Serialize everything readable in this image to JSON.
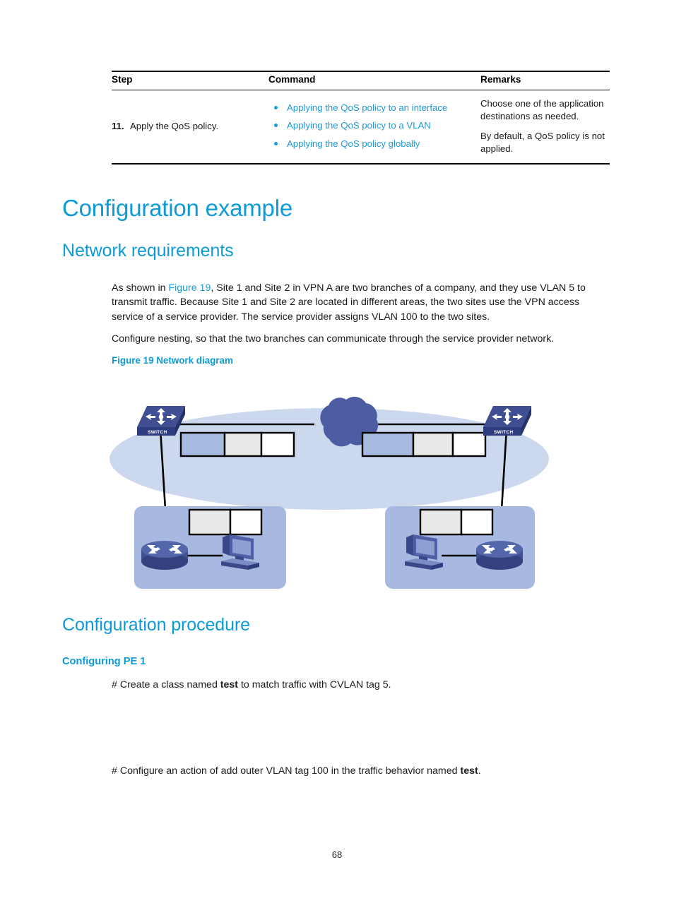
{
  "table": {
    "headers": [
      "Step",
      "Command",
      "Remarks"
    ],
    "rows": [
      {
        "step_number": "11.",
        "step_label": "Apply the QoS policy.",
        "commands": [
          "Applying the QoS policy to an interface",
          "Applying the QoS policy to a VLAN",
          "Applying the QoS policy globally"
        ],
        "remarks": [
          "Choose one of the application destinations as needed.",
          "By default, a QoS policy is not applied."
        ]
      }
    ]
  },
  "headings": {
    "configuration_example": "Configuration example",
    "network_requirements": "Network requirements",
    "configuration_procedure": "Configuration procedure",
    "configuring_pe1": "Configuring PE 1"
  },
  "body": {
    "intro_pre": "As shown in ",
    "intro_link": "Figure 19",
    "intro_post": ", Site 1 and Site 2 in VPN A are two branches of a company, and they use VLAN 5 to transmit traffic. Because Site 1 and Site 2 are located in different areas, the two sites use the VPN access service of a service provider. The service provider assigns VLAN 100 to the two sites.",
    "nesting": "Configure nesting, so that the two branches can communicate through the service provider network.",
    "figure_caption": "Figure 19 Network diagram",
    "create_class_pre": "# Create a class named ",
    "create_class_bold": "test",
    "create_class_post": " to match traffic with CVLAN tag 5.",
    "action_pre": "# Configure an action of add outer VLAN tag 100 in the traffic behavior named ",
    "action_bold": "test",
    "action_post": "."
  },
  "diagram": {
    "cloud_label": "",
    "switch_left_label": "SWITCH",
    "switch_right_label": "SWITCH",
    "labels": {
      "pe_left": "",
      "pe_right": "",
      "site_left": "",
      "site_right": ""
    },
    "colors": {
      "ellipse_fill": "#ccd8ee",
      "cloud_fill": "#4d5da3",
      "site_fill": "#a7b9e0",
      "box_blue": "#a7bbe0",
      "box_gray": "#e8e8e6",
      "box_white": "#ffffff",
      "device_dark": "#2e3d7d",
      "device_mid": "#4f5fa5",
      "device_light": "#7b8cc4",
      "line": "#000000"
    }
  },
  "footer": {
    "page_number": "68"
  },
  "theme": {
    "heading_blue": "#0d9bd7",
    "link_blue": "#1b9ad7",
    "text_black": "#1a1a1a"
  }
}
